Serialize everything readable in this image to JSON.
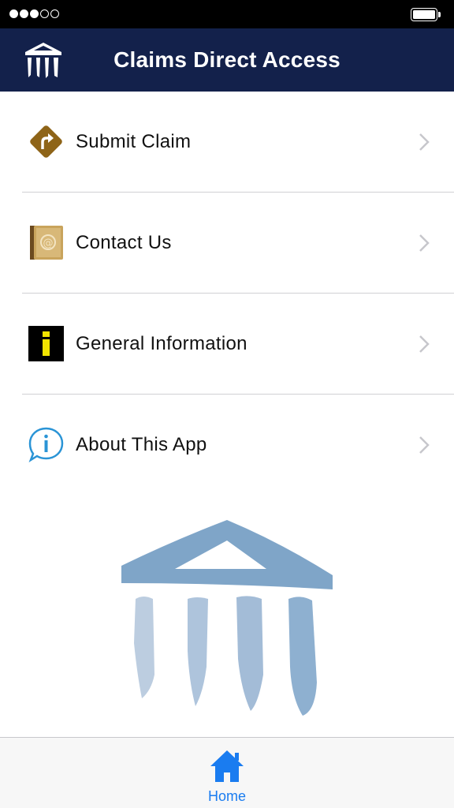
{
  "status_bar": {
    "signal_bars": 5,
    "signal_filled": 3,
    "battery_level": 0.9
  },
  "header": {
    "title": "Claims Direct Access",
    "logo_icon": "pillars-logo-icon",
    "background_color": "#13214b"
  },
  "menu": {
    "items": [
      {
        "label": "Submit Claim",
        "icon": "turn-sign-icon"
      },
      {
        "label": "Contact Us",
        "icon": "address-book-icon"
      },
      {
        "label": "General Information",
        "icon": "info-sign-icon"
      },
      {
        "label": "About This App",
        "icon": "info-bubble-icon"
      }
    ]
  },
  "tab_bar": {
    "tabs": [
      {
        "label": "Home",
        "icon": "home-icon",
        "selected": true,
        "color": "#1a7cf0"
      }
    ]
  }
}
